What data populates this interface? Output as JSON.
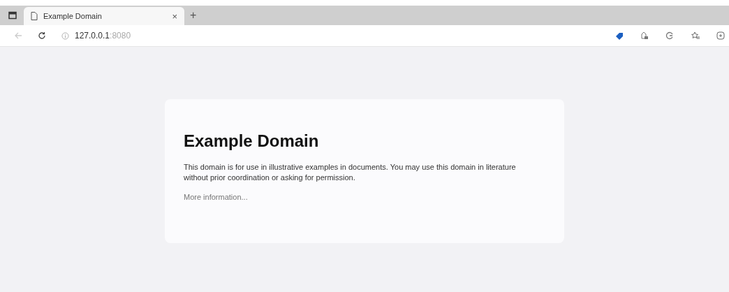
{
  "tabs": [
    {
      "title": "Example Domain",
      "close": "×",
      "selected": true
    }
  ],
  "new_tab": "+",
  "address_bar": {
    "host": "127.0.0.1",
    "port": ":8080"
  },
  "page": {
    "heading": "Example Domain",
    "paragraph": "This domain is for use in illustrative examples in documents. You may use this domain in literature without prior coordination or asking for permission.",
    "link": "More information..."
  }
}
